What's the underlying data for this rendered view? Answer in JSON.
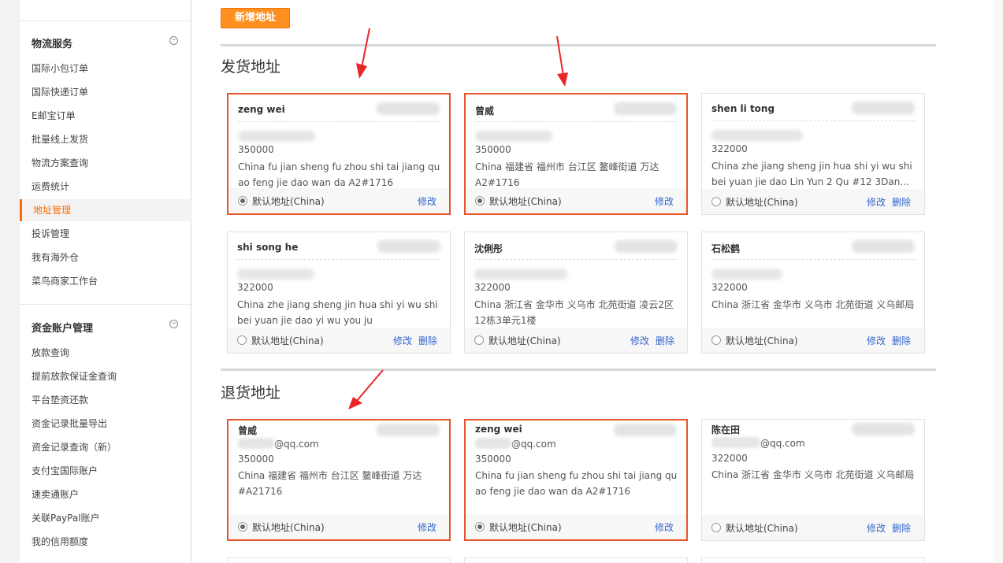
{
  "sidebar": {
    "groups": [
      {
        "title": "物流服务",
        "toggle": "−",
        "items": [
          "国际小包订单",
          "国际快递订单",
          "E邮宝订单",
          "批量线上发货",
          "物流方案查询",
          "运费统计",
          "地址管理",
          "投诉管理",
          "我有海外仓",
          "菜鸟商家工作台"
        ]
      },
      {
        "title": "资金账户管理",
        "toggle": "−",
        "items": [
          "放款查询",
          "提前放款保证金查询",
          "平台垫资还款",
          "资金记录批量导出",
          "资金记录查询（新）",
          "支付宝国际账户",
          "速卖通账户",
          "关联PayPal账户",
          "我的信用额度"
        ]
      }
    ],
    "active_item": "地址管理"
  },
  "main": {
    "add_button": "新增地址",
    "ship_title": "发货地址",
    "return_title": "退货地址",
    "default_text": "默认地址(China)",
    "edit_text": "修改",
    "delete_text": "删除",
    "ship_cards": [
      {
        "name": "zeng wei",
        "zip": "350000",
        "addr": "China fu jian sheng fu zhou shi tai jiang qu ao feng jie dao wan da A2#1716",
        "default": true
      },
      {
        "name": "曾威",
        "zip": "350000",
        "addr": "China 福建省 福州市 台江区 鳌峰街道 万达 A2#1716",
        "default": true
      },
      {
        "name": "shen li tong",
        "zip": "322000",
        "addr": "China zhe jiang sheng jin hua shi yi wu shi bei yuan jie dao Lin Yun 2 Qu #12 3Dan...",
        "default": false
      },
      {
        "name": "shi song he",
        "zip": "322000",
        "addr": "China zhe jiang sheng jin hua shi yi wu shi bei yuan jie dao yi wu you ju",
        "default": false
      },
      {
        "name": "沈俐彤",
        "zip": "322000",
        "addr": "China 浙江省 金华市 义乌市 北苑街道 凌云2区 12栋3单元1楼",
        "default": false
      },
      {
        "name": "石松鹤",
        "zip": "322000",
        "addr": "China 浙江省 金华市 义乌市 北苑街道 义乌邮局",
        "default": false
      }
    ],
    "return_cards": [
      {
        "name": "曾威",
        "email": "@qq.com",
        "zip": "350000",
        "addr": "China 福建省 福州市 台江区 鳌峰街道 万达 #A21716",
        "default": true
      },
      {
        "name": "zeng wei",
        "email": "@qq.com",
        "zip": "350000",
        "addr": "China fu jian sheng fu zhou shi tai jiang qu ao feng jie dao wan da A2#1716",
        "default": true
      },
      {
        "name": "陈在田",
        "email": "@qq.com",
        "zip": "322000",
        "addr": "China 浙江省 金华市 义乌市 北苑街道 义乌邮局",
        "default": false
      }
    ]
  },
  "colors": {
    "accent": "#ff6a00",
    "button": "#ff8f1f",
    "highlight_border": "#e8542a",
    "link": "#3366cc"
  }
}
